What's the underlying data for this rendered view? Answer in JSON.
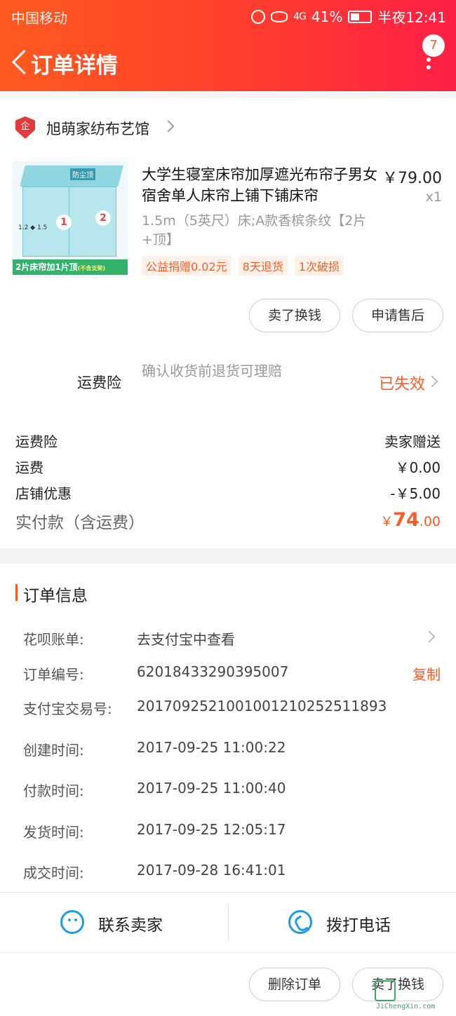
{
  "status_bar": {
    "carrier": "中国移动",
    "network": "4G",
    "battery": "41%",
    "time": "半夜12:41"
  },
  "header": {
    "title": "订单详情",
    "more_badge": "7"
  },
  "store": {
    "logo_text": "企",
    "name": "旭萌家纺布艺馆"
  },
  "product": {
    "title": "大学生寝室床帘加厚遮光布帘子男女宿舍单人床帘上铺下铺床帘",
    "price": "￥79.00",
    "quantity": "x1",
    "spec": "1.5m（5英尺）床;A款香槟条纹【2片+顶】",
    "image_texts": {
      "top_tag": "防尘顶",
      "caption": "2片床帘加1片顶",
      "caption_note": "(不含支架)",
      "dims": "1.2 ◆ 1.5",
      "panel_1": "1",
      "panel_2": "2"
    },
    "tags": [
      "公益捐赠0.02元",
      "8天退货",
      "1次破损"
    ]
  },
  "item_actions": {
    "sell_btn": "卖了换钱",
    "after_sale_btn": "申请售后"
  },
  "insurance": {
    "label": "运费险",
    "desc": "确认收货前退货可理赔",
    "status": "已失效"
  },
  "summary": {
    "rows": [
      {
        "k": "运费险",
        "v": "卖家赠送"
      },
      {
        "k": "运费",
        "v": "￥0.00"
      },
      {
        "k": "店铺优惠",
        "v": "-￥5.00"
      }
    ],
    "total_label": "实付款（含运费）",
    "total_currency": "￥",
    "total_int": "74",
    "total_dec": ".00"
  },
  "order_info": {
    "title": "订单信息",
    "rows": [
      {
        "k": "花呗账单:",
        "v": "去支付宝中查看"
      },
      {
        "k": "订单编号:",
        "v": "62018433290395007",
        "action": "复制"
      },
      {
        "k": "支付宝交易号:",
        "v": "2017092521001001210252511893"
      },
      {
        "k": "创建时间:",
        "v": "2017-09-25 11:00:22"
      },
      {
        "k": "付款时间:",
        "v": "2017-09-25 11:00:40"
      },
      {
        "k": "发货时间:",
        "v": "2017-09-25 12:05:17"
      },
      {
        "k": "成交时间:",
        "v": "2017-09-28 16:41:01"
      }
    ]
  },
  "contact": {
    "seller": "联系卖家",
    "call": "拨打电话"
  },
  "bottom_actions": {
    "delete": "删除订单",
    "sell": "卖了换钱"
  },
  "watermark": "JiChengXin.com"
}
